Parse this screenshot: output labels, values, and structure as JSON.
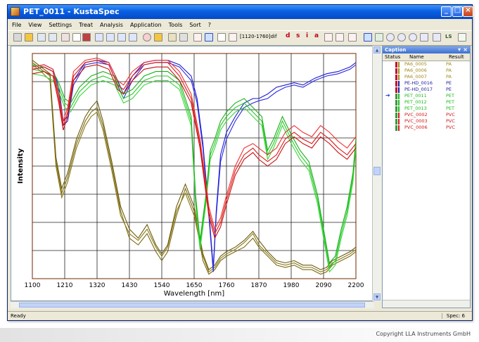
{
  "window": {
    "title": "PET_0011 - KustaSpec"
  },
  "menu": [
    "File",
    "View",
    "Settings",
    "Treat",
    "Analysis",
    "Application",
    "Tools",
    "Sort",
    "?"
  ],
  "toolbar": {
    "range_text": "[1120-1760]dif",
    "letters": [
      "d",
      "s",
      "i",
      "a"
    ],
    "ls_label": "LS"
  },
  "caption_panel": {
    "title": "Caption",
    "close_glyph": "×",
    "pin_glyph": "▾",
    "columns": {
      "status": "Status",
      "name": "Name",
      "result": "Result"
    },
    "rows": [
      {
        "name": "PA6_0005",
        "result": "PA",
        "color": "#a08a1a",
        "bar": "#c0102a"
      },
      {
        "name": "PA6_0006",
        "result": "PA",
        "color": "#a08a1a",
        "bar": "#c0102a"
      },
      {
        "name": "PA6_0007",
        "result": "PA",
        "color": "#a08a1a",
        "bar": "#c0102a"
      },
      {
        "name": "PE-HD_0016",
        "result": "PE",
        "color": "#1a1aa0",
        "bar": "#c0102a"
      },
      {
        "name": "PE-HD_0017",
        "result": "PE",
        "color": "#1a1aa0",
        "bar": "#c0102a"
      },
      {
        "name": "PET_0011",
        "result": "PET",
        "color": "#1fb81f",
        "bar": "#3a9a3a",
        "current": true
      },
      {
        "name": "PET_0012",
        "result": "PET",
        "color": "#1fb81f",
        "bar": "#3a9a3a"
      },
      {
        "name": "PET_0013",
        "result": "PET",
        "color": "#1fb81f",
        "bar": "#3a9a3a"
      },
      {
        "name": "PVC_0002",
        "result": "PVC",
        "color": "#d01818",
        "bar": "#3a9a3a"
      },
      {
        "name": "PVC_0003",
        "result": "PVC",
        "color": "#d01818",
        "bar": "#3a9a3a"
      },
      {
        "name": "PVC_0006",
        "result": "PVC",
        "color": "#d01818",
        "bar": "#3a9a3a"
      }
    ]
  },
  "status": {
    "left": "Ready",
    "right": "Spec: 6"
  },
  "copyright": "Copyright LLA Instruments GmbH",
  "chart_data": {
    "type": "line",
    "xlabel": "Wavelength [nm]",
    "ylabel": "Intensity",
    "xlim": [
      1100,
      2200
    ],
    "ylim": [
      0,
      1
    ],
    "x_ticks": [
      1100,
      1210,
      1320,
      1430,
      1540,
      1650,
      1760,
      1870,
      1980,
      2090,
      2200
    ],
    "grid": true,
    "series": [
      {
        "name": "PA6_0005",
        "color": "#7a6a10",
        "x": [
          1100,
          1130,
          1160,
          1180,
          1200,
          1220,
          1250,
          1280,
          1300,
          1320,
          1340,
          1370,
          1400,
          1430,
          1460,
          1490,
          1520,
          1540,
          1560,
          1590,
          1620,
          1650,
          1680,
          1700,
          1720,
          1740,
          1760,
          1790,
          1820,
          1850,
          1870,
          1900,
          1930,
          1960,
          1990,
          2020,
          2050,
          2080,
          2100,
          2120,
          2150,
          2180,
          2200
        ],
        "y": [
          0.96,
          0.93,
          0.9,
          0.52,
          0.38,
          0.45,
          0.6,
          0.7,
          0.74,
          0.76,
          0.68,
          0.5,
          0.3,
          0.18,
          0.15,
          0.2,
          0.12,
          0.08,
          0.12,
          0.28,
          0.4,
          0.3,
          0.08,
          0.02,
          0.04,
          0.08,
          0.1,
          0.12,
          0.14,
          0.18,
          0.14,
          0.1,
          0.06,
          0.05,
          0.06,
          0.04,
          0.04,
          0.02,
          0.03,
          0.06,
          0.08,
          0.1,
          0.12
        ]
      },
      {
        "name": "PA6_0006",
        "color": "#8a7a18",
        "x": [
          1100,
          1130,
          1160,
          1180,
          1200,
          1220,
          1250,
          1280,
          1300,
          1320,
          1340,
          1370,
          1400,
          1430,
          1460,
          1490,
          1520,
          1540,
          1560,
          1590,
          1620,
          1650,
          1680,
          1700,
          1720,
          1740,
          1760,
          1790,
          1820,
          1850,
          1870,
          1900,
          1930,
          1960,
          1990,
          2020,
          2050,
          2080,
          2100,
          2120,
          2150,
          2180,
          2200
        ],
        "y": [
          0.95,
          0.92,
          0.88,
          0.5,
          0.36,
          0.43,
          0.58,
          0.68,
          0.72,
          0.74,
          0.66,
          0.48,
          0.28,
          0.2,
          0.17,
          0.22,
          0.14,
          0.1,
          0.14,
          0.3,
          0.38,
          0.28,
          0.1,
          0.03,
          0.05,
          0.09,
          0.11,
          0.13,
          0.16,
          0.2,
          0.15,
          0.11,
          0.07,
          0.06,
          0.07,
          0.05,
          0.05,
          0.03,
          0.04,
          0.07,
          0.09,
          0.11,
          0.13
        ]
      },
      {
        "name": "PA6_0007",
        "color": "#6a5a0a",
        "x": [
          1100,
          1130,
          1160,
          1180,
          1200,
          1220,
          1250,
          1280,
          1300,
          1320,
          1340,
          1370,
          1400,
          1430,
          1460,
          1490,
          1520,
          1540,
          1560,
          1590,
          1620,
          1650,
          1680,
          1700,
          1720,
          1740,
          1760,
          1790,
          1820,
          1850,
          1870,
          1900,
          1930,
          1960,
          1990,
          2020,
          2050,
          2080,
          2100,
          2120,
          2150,
          2180,
          2200
        ],
        "y": [
          0.97,
          0.94,
          0.91,
          0.54,
          0.4,
          0.47,
          0.62,
          0.72,
          0.76,
          0.79,
          0.7,
          0.52,
          0.32,
          0.22,
          0.18,
          0.24,
          0.15,
          0.11,
          0.15,
          0.32,
          0.42,
          0.32,
          0.11,
          0.04,
          0.06,
          0.1,
          0.12,
          0.14,
          0.17,
          0.21,
          0.17,
          0.12,
          0.08,
          0.07,
          0.08,
          0.06,
          0.06,
          0.04,
          0.05,
          0.08,
          0.1,
          0.12,
          0.14
        ]
      },
      {
        "name": "PE-HD_0016",
        "color": "#1a1ad0",
        "x": [
          1100,
          1140,
          1170,
          1190,
          1205,
          1220,
          1240,
          1280,
          1320,
          1360,
          1390,
          1410,
          1440,
          1480,
          1520,
          1560,
          1600,
          1640,
          1660,
          1680,
          1700,
          1715,
          1725,
          1740,
          1760,
          1790,
          1820,
          1850,
          1870,
          1900,
          1930,
          1960,
          1990,
          2020,
          2060,
          2100,
          2140,
          2180,
          2200
        ],
        "y": [
          0.94,
          0.95,
          0.93,
          0.85,
          0.7,
          0.72,
          0.88,
          0.96,
          0.97,
          0.96,
          0.88,
          0.82,
          0.9,
          0.96,
          0.97,
          0.97,
          0.95,
          0.9,
          0.8,
          0.6,
          0.3,
          0.05,
          0.3,
          0.55,
          0.65,
          0.72,
          0.78,
          0.8,
          0.8,
          0.82,
          0.85,
          0.86,
          0.87,
          0.86,
          0.89,
          0.91,
          0.92,
          0.94,
          0.96
        ]
      },
      {
        "name": "PE-HD_0017",
        "color": "#2a2ae0",
        "x": [
          1100,
          1140,
          1170,
          1190,
          1205,
          1220,
          1240,
          1280,
          1320,
          1360,
          1390,
          1410,
          1440,
          1480,
          1520,
          1560,
          1600,
          1640,
          1660,
          1680,
          1700,
          1715,
          1725,
          1740,
          1760,
          1790,
          1820,
          1850,
          1870,
          1900,
          1930,
          1960,
          1990,
          2020,
          2060,
          2100,
          2140,
          2180,
          2200
        ],
        "y": [
          0.93,
          0.94,
          0.92,
          0.83,
          0.68,
          0.7,
          0.86,
          0.95,
          0.96,
          0.95,
          0.86,
          0.8,
          0.88,
          0.95,
          0.96,
          0.96,
          0.94,
          0.88,
          0.78,
          0.58,
          0.28,
          0.03,
          0.28,
          0.52,
          0.62,
          0.7,
          0.76,
          0.78,
          0.79,
          0.8,
          0.83,
          0.85,
          0.86,
          0.85,
          0.88,
          0.9,
          0.91,
          0.93,
          0.95
        ]
      },
      {
        "name": "PET_0011",
        "color": "#28c828",
        "x": [
          1100,
          1140,
          1170,
          1190,
          1210,
          1230,
          1260,
          1300,
          1340,
          1380,
          1410,
          1440,
          1480,
          1520,
          1560,
          1600,
          1640,
          1655,
          1670,
          1690,
          1705,
          1720,
          1740,
          1760,
          1790,
          1820,
          1850,
          1880,
          1900,
          1920,
          1950,
          1980,
          2010,
          2040,
          2070,
          2090,
          2110,
          2130,
          2150,
          2170,
          2190,
          2200
        ],
        "y": [
          0.93,
          0.92,
          0.9,
          0.85,
          0.78,
          0.76,
          0.83,
          0.88,
          0.9,
          0.88,
          0.8,
          0.82,
          0.88,
          0.9,
          0.9,
          0.86,
          0.7,
          0.35,
          0.15,
          0.35,
          0.55,
          0.6,
          0.68,
          0.72,
          0.76,
          0.78,
          0.74,
          0.7,
          0.55,
          0.6,
          0.7,
          0.62,
          0.55,
          0.5,
          0.35,
          0.2,
          0.05,
          0.08,
          0.2,
          0.3,
          0.45,
          0.6
        ]
      },
      {
        "name": "PET_0012",
        "color": "#3ad83a",
        "x": [
          1100,
          1140,
          1170,
          1190,
          1210,
          1230,
          1260,
          1300,
          1340,
          1380,
          1410,
          1440,
          1480,
          1520,
          1560,
          1600,
          1640,
          1655,
          1670,
          1690,
          1705,
          1720,
          1740,
          1760,
          1790,
          1820,
          1850,
          1880,
          1900,
          1920,
          1950,
          1980,
          2010,
          2040,
          2070,
          2090,
          2110,
          2130,
          2150,
          2170,
          2190,
          2200
        ],
        "y": [
          0.91,
          0.9,
          0.88,
          0.83,
          0.76,
          0.74,
          0.81,
          0.86,
          0.88,
          0.86,
          0.78,
          0.8,
          0.86,
          0.88,
          0.88,
          0.84,
          0.68,
          0.33,
          0.13,
          0.33,
          0.53,
          0.58,
          0.66,
          0.7,
          0.74,
          0.76,
          0.72,
          0.68,
          0.53,
          0.58,
          0.68,
          0.6,
          0.53,
          0.48,
          0.33,
          0.18,
          0.03,
          0.06,
          0.18,
          0.28,
          0.43,
          0.58
        ]
      },
      {
        "name": "PET_0013",
        "color": "#18b018",
        "x": [
          1100,
          1140,
          1170,
          1190,
          1210,
          1230,
          1260,
          1300,
          1340,
          1380,
          1410,
          1440,
          1480,
          1520,
          1560,
          1600,
          1640,
          1655,
          1670,
          1690,
          1705,
          1720,
          1740,
          1760,
          1790,
          1820,
          1850,
          1880,
          1900,
          1920,
          1950,
          1980,
          2010,
          2040,
          2070,
          2090,
          2110,
          2130,
          2150,
          2170,
          2190,
          2200
        ],
        "y": [
          0.95,
          0.94,
          0.92,
          0.87,
          0.8,
          0.78,
          0.85,
          0.9,
          0.92,
          0.9,
          0.82,
          0.84,
          0.9,
          0.92,
          0.92,
          0.88,
          0.72,
          0.37,
          0.17,
          0.37,
          0.57,
          0.62,
          0.7,
          0.74,
          0.78,
          0.8,
          0.76,
          0.72,
          0.57,
          0.62,
          0.72,
          0.64,
          0.57,
          0.52,
          0.37,
          0.22,
          0.07,
          0.1,
          0.22,
          0.32,
          0.47,
          0.62
        ]
      },
      {
        "name": "PVC_0002",
        "color": "#e01818",
        "x": [
          1100,
          1140,
          1170,
          1190,
          1205,
          1220,
          1240,
          1280,
          1320,
          1360,
          1390,
          1410,
          1440,
          1480,
          1520,
          1560,
          1600,
          1640,
          1670,
          1700,
          1720,
          1740,
          1760,
          1790,
          1820,
          1850,
          1870,
          1900,
          1930,
          1960,
          1990,
          2020,
          2050,
          2080,
          2110,
          2140,
          2170,
          2200
        ],
        "y": [
          0.93,
          0.94,
          0.92,
          0.8,
          0.68,
          0.74,
          0.9,
          0.96,
          0.97,
          0.95,
          0.86,
          0.84,
          0.9,
          0.95,
          0.96,
          0.96,
          0.9,
          0.8,
          0.6,
          0.3,
          0.2,
          0.25,
          0.35,
          0.48,
          0.55,
          0.58,
          0.55,
          0.52,
          0.55,
          0.62,
          0.65,
          0.62,
          0.6,
          0.65,
          0.62,
          0.58,
          0.55,
          0.6
        ]
      },
      {
        "name": "PVC_0003",
        "color": "#c81010",
        "x": [
          1100,
          1140,
          1170,
          1190,
          1205,
          1220,
          1240,
          1280,
          1320,
          1360,
          1390,
          1410,
          1440,
          1480,
          1520,
          1560,
          1600,
          1640,
          1670,
          1700,
          1720,
          1740,
          1760,
          1790,
          1820,
          1850,
          1870,
          1900,
          1930,
          1960,
          1990,
          2020,
          2050,
          2080,
          2110,
          2140,
          2170,
          2200
        ],
        "y": [
          0.91,
          0.92,
          0.9,
          0.78,
          0.66,
          0.72,
          0.88,
          0.94,
          0.95,
          0.93,
          0.84,
          0.82,
          0.88,
          0.93,
          0.94,
          0.94,
          0.88,
          0.78,
          0.58,
          0.28,
          0.18,
          0.23,
          0.33,
          0.46,
          0.53,
          0.56,
          0.53,
          0.5,
          0.53,
          0.6,
          0.63,
          0.6,
          0.58,
          0.63,
          0.6,
          0.56,
          0.53,
          0.58
        ]
      },
      {
        "name": "PVC_0006",
        "color": "#f03030",
        "x": [
          1100,
          1140,
          1170,
          1190,
          1205,
          1220,
          1240,
          1280,
          1320,
          1360,
          1390,
          1410,
          1440,
          1480,
          1520,
          1560,
          1600,
          1640,
          1670,
          1700,
          1720,
          1740,
          1760,
          1790,
          1820,
          1850,
          1870,
          1900,
          1930,
          1960,
          1990,
          2020,
          2050,
          2080,
          2110,
          2140,
          2170,
          2200
        ],
        "y": [
          0.94,
          0.95,
          0.93,
          0.82,
          0.7,
          0.76,
          0.92,
          0.97,
          0.98,
          0.96,
          0.88,
          0.86,
          0.92,
          0.96,
          0.97,
          0.97,
          0.92,
          0.82,
          0.62,
          0.32,
          0.22,
          0.27,
          0.37,
          0.5,
          0.58,
          0.6,
          0.58,
          0.55,
          0.58,
          0.65,
          0.68,
          0.65,
          0.63,
          0.68,
          0.65,
          0.61,
          0.58,
          0.63
        ]
      }
    ]
  }
}
